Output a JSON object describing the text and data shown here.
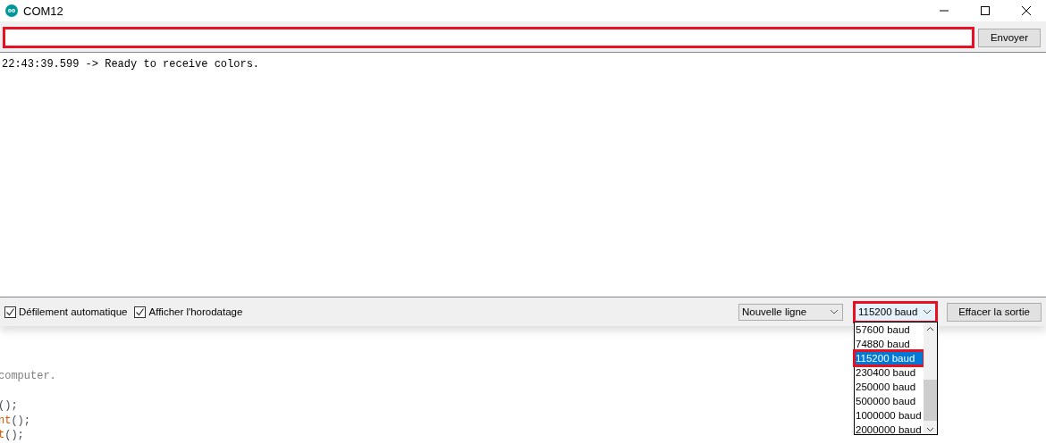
{
  "window": {
    "title": "COM12"
  },
  "send_bar": {
    "input": {
      "highlighted": true
    },
    "send_button": "Envoyer"
  },
  "output": {
    "lines": [
      "22:43:39.599 -> Ready to receive colors."
    ]
  },
  "bottom_bar": {
    "checkboxes": [
      {
        "label": "Défilement automatique",
        "checked": true
      },
      {
        "label": "Afficher l'horodatage",
        "checked": true
      }
    ],
    "line_ending": {
      "value": "Nouvelle ligne"
    },
    "baud_select": {
      "value": "115200 baud",
      "highlighted": true,
      "expanded": true,
      "options": [
        {
          "label": "57600 baud",
          "selected": false
        },
        {
          "label": "74880 baud",
          "selected": false
        },
        {
          "label": "115200 baud",
          "selected": true
        },
        {
          "label": "230400 baud",
          "selected": false
        },
        {
          "label": "250000 baud",
          "selected": false
        },
        {
          "label": "500000 baud",
          "selected": false
        },
        {
          "label": "1000000 baud",
          "selected": false
        },
        {
          "label": "2000000 baud",
          "selected": false
        }
      ]
    },
    "clear_button": "Effacer la sortie"
  },
  "background_code": [
    {
      "blank_before": false,
      "segments": [
        {
          "text": "computer.",
          "kind": "comment"
        }
      ]
    },
    {
      "blank_before": true,
      "segments": [
        {
          "text": "();",
          "kind": "plain"
        }
      ]
    },
    {
      "blank_before": false,
      "segments": [
        {
          "text": "nt",
          "kind": "function"
        },
        {
          "text": "();",
          "kind": "plain"
        }
      ]
    },
    {
      "blank_before": false,
      "segments": [
        {
          "text": "t",
          "kind": "function"
        },
        {
          "text": "();",
          "kind": "plain"
        }
      ]
    }
  ]
}
